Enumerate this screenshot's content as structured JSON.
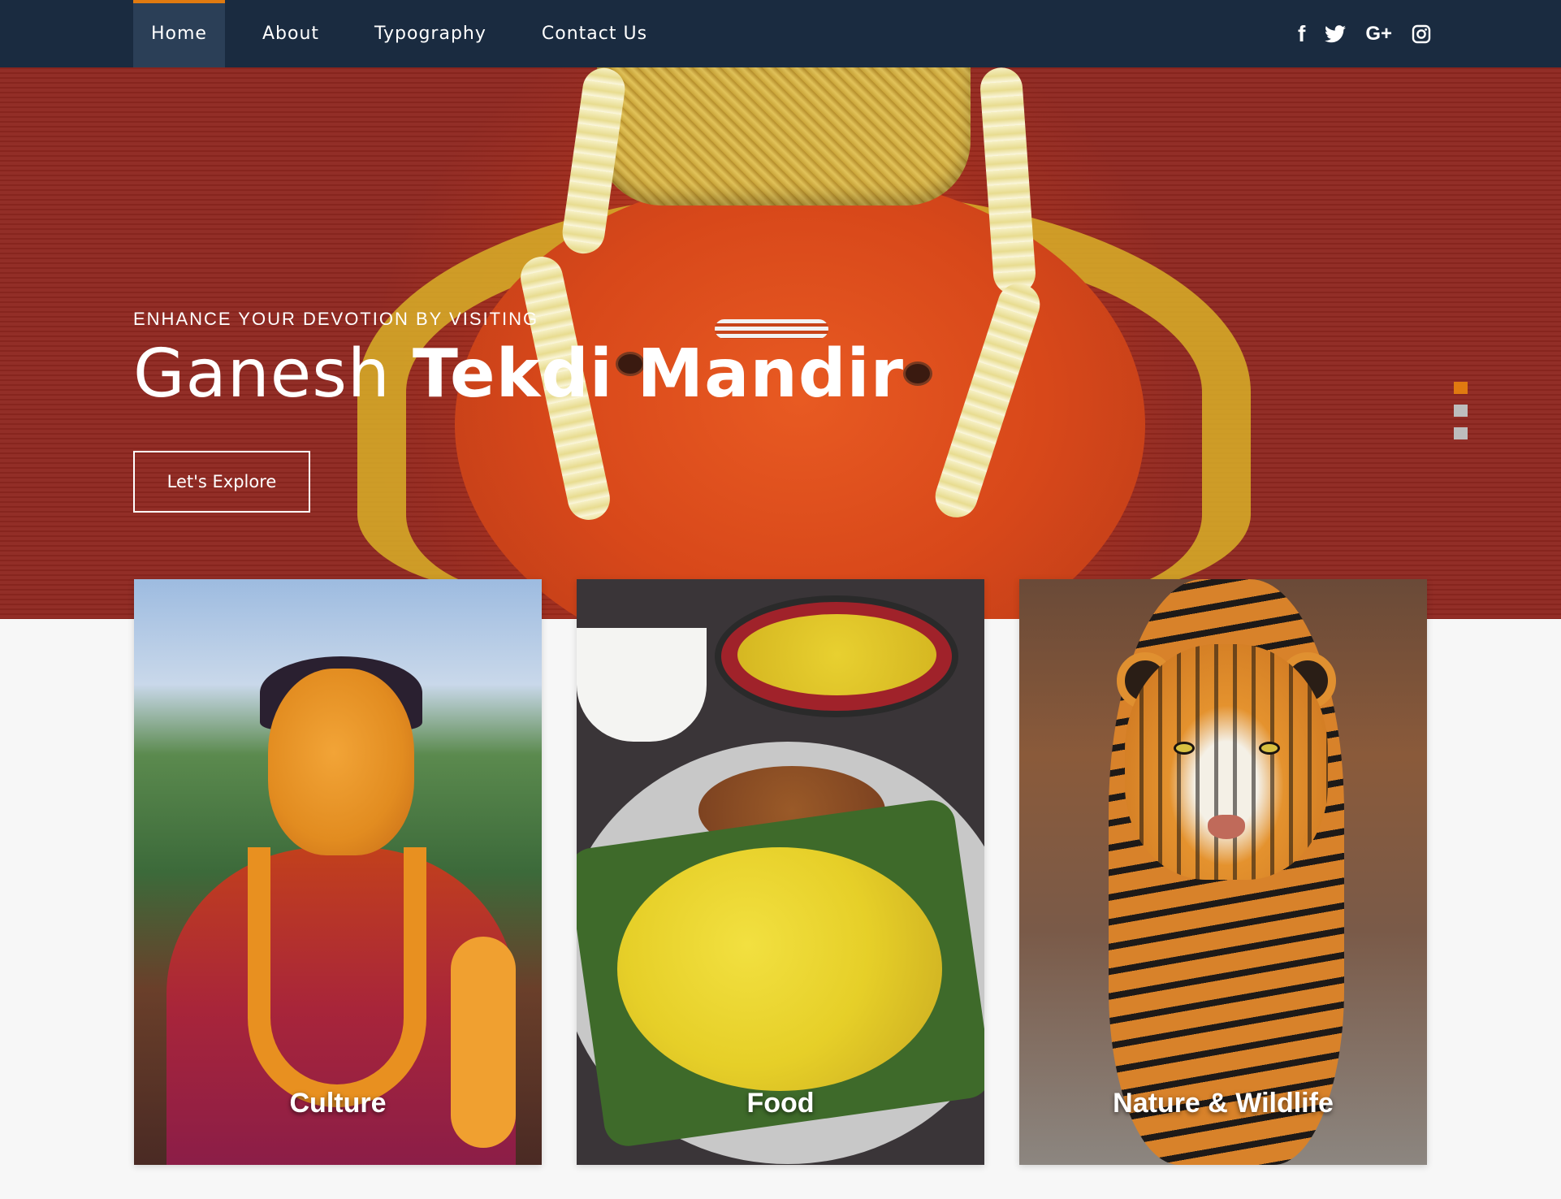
{
  "nav": {
    "items": [
      {
        "label": "Home",
        "active": true
      },
      {
        "label": "About",
        "active": false
      },
      {
        "label": "Typography",
        "active": false
      },
      {
        "label": "Contact Us",
        "active": false
      }
    ],
    "social": [
      {
        "name": "facebook-icon",
        "glyph": "f"
      },
      {
        "name": "twitter-icon",
        "glyph": "🐦"
      },
      {
        "name": "google-plus-icon",
        "glyph": "G+"
      },
      {
        "name": "instagram-icon",
        "glyph": "◎"
      }
    ]
  },
  "hero": {
    "subtitle": "ENHANCE YOUR DEVOTION BY VISITING",
    "title_light": "Ganesh",
    "title_bold": "Tekdi Mandir",
    "button_label": "Let's Explore",
    "slides": 3,
    "active_slide": 1
  },
  "cards": [
    {
      "label": "Culture"
    },
    {
      "label": "Food"
    },
    {
      "label": "Nature & Wildlife"
    }
  ],
  "colors": {
    "nav_bg": "#1a2b40",
    "accent": "#e07a10",
    "hero_red": "#c83a18"
  }
}
